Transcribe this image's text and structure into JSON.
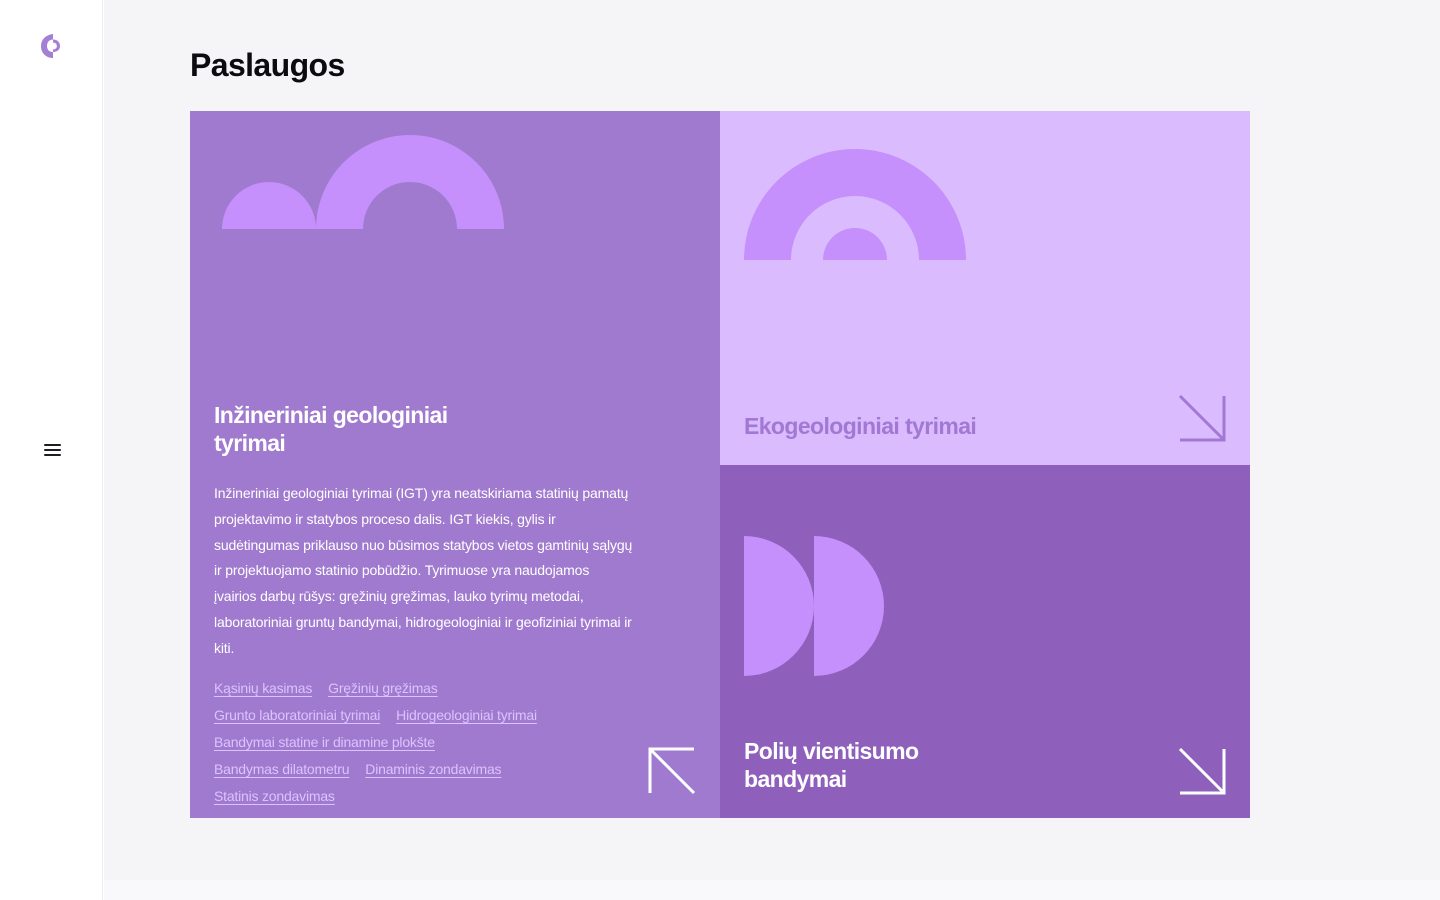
{
  "colors": {
    "brand": "#a47fd6",
    "card_primary": "#a07ace",
    "card_light": "#dabbfd",
    "card_dark": "#8e60bc",
    "shape": "#c58ffc",
    "link": "#dcc3ff"
  },
  "sidebar": {
    "logo_icon": "brand-logo-icon",
    "menu_icon": "hamburger-menu-icon"
  },
  "page": {
    "title": "Paslaugos"
  },
  "services": [
    {
      "title": "Inžineriniai geologiniai tyrimai",
      "description": "Inžineriniai geologiniai tyrimai (IGT) yra neatskiriama statinių pamatų projektavimo ir statybos proceso dalis. IGT kiekis, gylis ir sudėtingumas priklauso nuo būsimos statybos vietos gamtinių sąlygų ir projektuojamo statinio pobūdžio. Tyrimuose yra naudojamos įvairios darbų rūšys: gręžinių gręžimas, lauko tyrimų metodai, laboratoriniai gruntų bandymai, hidrogeologiniai ir geofiziniai tyrimai ir kiti.",
      "links": [
        "Kąsinių kasimas",
        "Gręžinių gręžimas",
        "Grunto laboratoriniai tyrimai",
        "Hidrogeologiniai tyrimai",
        "Bandymai statine ir dinamine plokšte",
        "Bandymas dilatometru",
        "Dinaminis zondavimas",
        "Statinis zondavimas"
      ],
      "arrow_icon": "arrow-up-left-icon"
    },
    {
      "title": "Ekogeologiniai tyrimai",
      "arrow_icon": "arrow-down-right-icon"
    },
    {
      "title": "Polių vientisumo bandymai",
      "arrow_icon": "arrow-down-right-icon"
    }
  ]
}
